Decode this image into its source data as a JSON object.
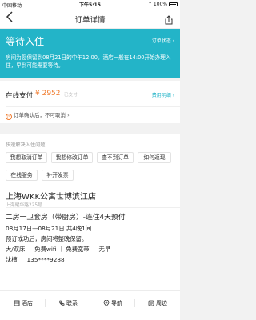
{
  "status_bar": {
    "carrier": "中国移动",
    "time": "下午5:15",
    "right": "⇡ 100% "
  },
  "nav": {
    "back_icon": "‹",
    "title": "订单详情",
    "share_icon": "share-icon"
  },
  "banner": {
    "title": "等待入住",
    "status_link": "订单状态 ›",
    "description": "房间为您保留到08月21日的中午12:00。酒店一般在14:00开始办理入住，早到可能需要等待。"
  },
  "payment": {
    "label": "在线支付",
    "amount": "¥ 2952",
    "badge": "已支付",
    "detail_link": "费用明细 ›",
    "cancel_note": "订单确认后，不可取消 ›",
    "accent": "#f07a2c"
  },
  "quick_help": {
    "heading": "快速解决入住问题",
    "buttons": [
      "我想取消订单",
      "我想修改订单",
      "查不到订单",
      "如何返现",
      "在线服务",
      "补开发票"
    ]
  },
  "hotel": {
    "name": "上海WKK公寓世博滨江店",
    "address": "上海耀华路225号",
    "room": "二房一卫套房（带厨房）-连住4天预付",
    "lines": [
      "08月17日—08月21日 共4晚1间",
      "预订成功后，房间将整晚保留。",
      "大/双床 ｜ 免费wifi ｜ 免费宽带 ｜ 无早",
      "沈楠 ｜ 135****9288"
    ]
  },
  "actions": [
    "酒店",
    "联系",
    "导航",
    "周边"
  ],
  "colors": {
    "brand": "#23b4c8",
    "price": "#f07a2c"
  }
}
